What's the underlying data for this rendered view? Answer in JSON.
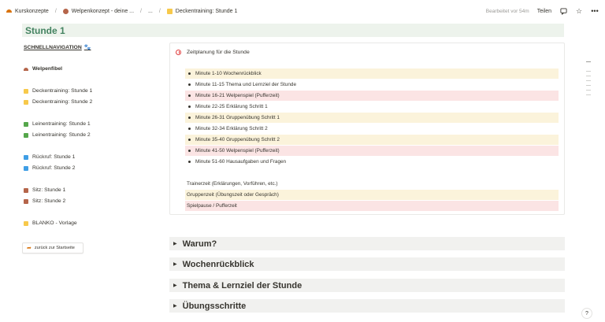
{
  "breadcrumb": {
    "items": [
      {
        "label": "Kurskonzepte",
        "icon": "rainbow-icon"
      },
      {
        "label": "Welpenkonzept - deine ...",
        "icon": "dog-icon"
      },
      {
        "label": "...",
        "icon": ""
      },
      {
        "label": "Deckentraining: Stunde 1",
        "icon": "yellow-square-icon"
      }
    ]
  },
  "topbar": {
    "edited": "Bearbeitet vor 54m",
    "share": "Teilen"
  },
  "page": {
    "title": "Stunde 1"
  },
  "sidebar": {
    "heading": "SCHNELLNAVIGATION",
    "items": [
      {
        "label": "Welpenfibel",
        "color": "#b5654a",
        "icon": "rainbow-icon",
        "bold": true
      },
      {
        "label": "Deckentraining: Stunde 1",
        "color": "#f7c94b"
      },
      {
        "label": "Deckentraining: Stunde 2",
        "color": "#f7c94b"
      },
      {
        "label": "Leinentraining: Stunde 1",
        "color": "#55a74b"
      },
      {
        "label": "Leinentraining: Stunde 2",
        "color": "#55a74b"
      },
      {
        "label": "Rückruf: Stunde 1",
        "color": "#3f9ee5"
      },
      {
        "label": "Rückruf: Stunde 2",
        "color": "#3f9ee5"
      },
      {
        "label": "Sitz: Stunde 1",
        "color": "#b5654a"
      },
      {
        "label": "Sitz: Stunde 2",
        "color": "#b5654a"
      },
      {
        "label": "BLANKO - Vorlage",
        "color": "#f7c94b"
      }
    ],
    "back_button": "zurück zur Startseite"
  },
  "callout": {
    "title": "Zeitplanung für die Stunde",
    "schedule": [
      {
        "label": "Minute 1-10 Wochenrückblick",
        "style": "yel"
      },
      {
        "label": "Minute 11-15 Thema und Lernziel der Stunde",
        "style": ""
      },
      {
        "label": "Minute 16-21 Welpenspiel (Pufferzeit)",
        "style": "red"
      },
      {
        "label": "Minute 22-25 Erklärung Schritt 1",
        "style": ""
      },
      {
        "label": "Minute 26-31 Gruppenübung Schritt 1",
        "style": "yel"
      },
      {
        "label": "Minute 32-34 Erklärung Schritt 2",
        "style": ""
      },
      {
        "label": "Minute 35-40 Gruppenübung Schritt 2",
        "style": "yel"
      },
      {
        "label": "Minute 41-50 Welpenspiel (Pufferzeit)",
        "style": "red"
      },
      {
        "label": "Minute 51-60 Hausaufgaben und Fragen",
        "style": ""
      }
    ],
    "legend": [
      {
        "label": "Trainerzeit (Erklärungen, Vorführen, etc.)",
        "style": ""
      },
      {
        "label": "Gruppenzeit (Übungszeit oder Gespräch)",
        "style": "yel"
      },
      {
        "label": "Spielpause / Pufferzeit",
        "style": "red"
      }
    ]
  },
  "toggles": [
    {
      "label": "Warum?"
    },
    {
      "label": "Wochenrückblick"
    },
    {
      "label": "Thema & Lernziel der Stunde"
    },
    {
      "label": "Übungsschritte"
    }
  ],
  "help": "?"
}
